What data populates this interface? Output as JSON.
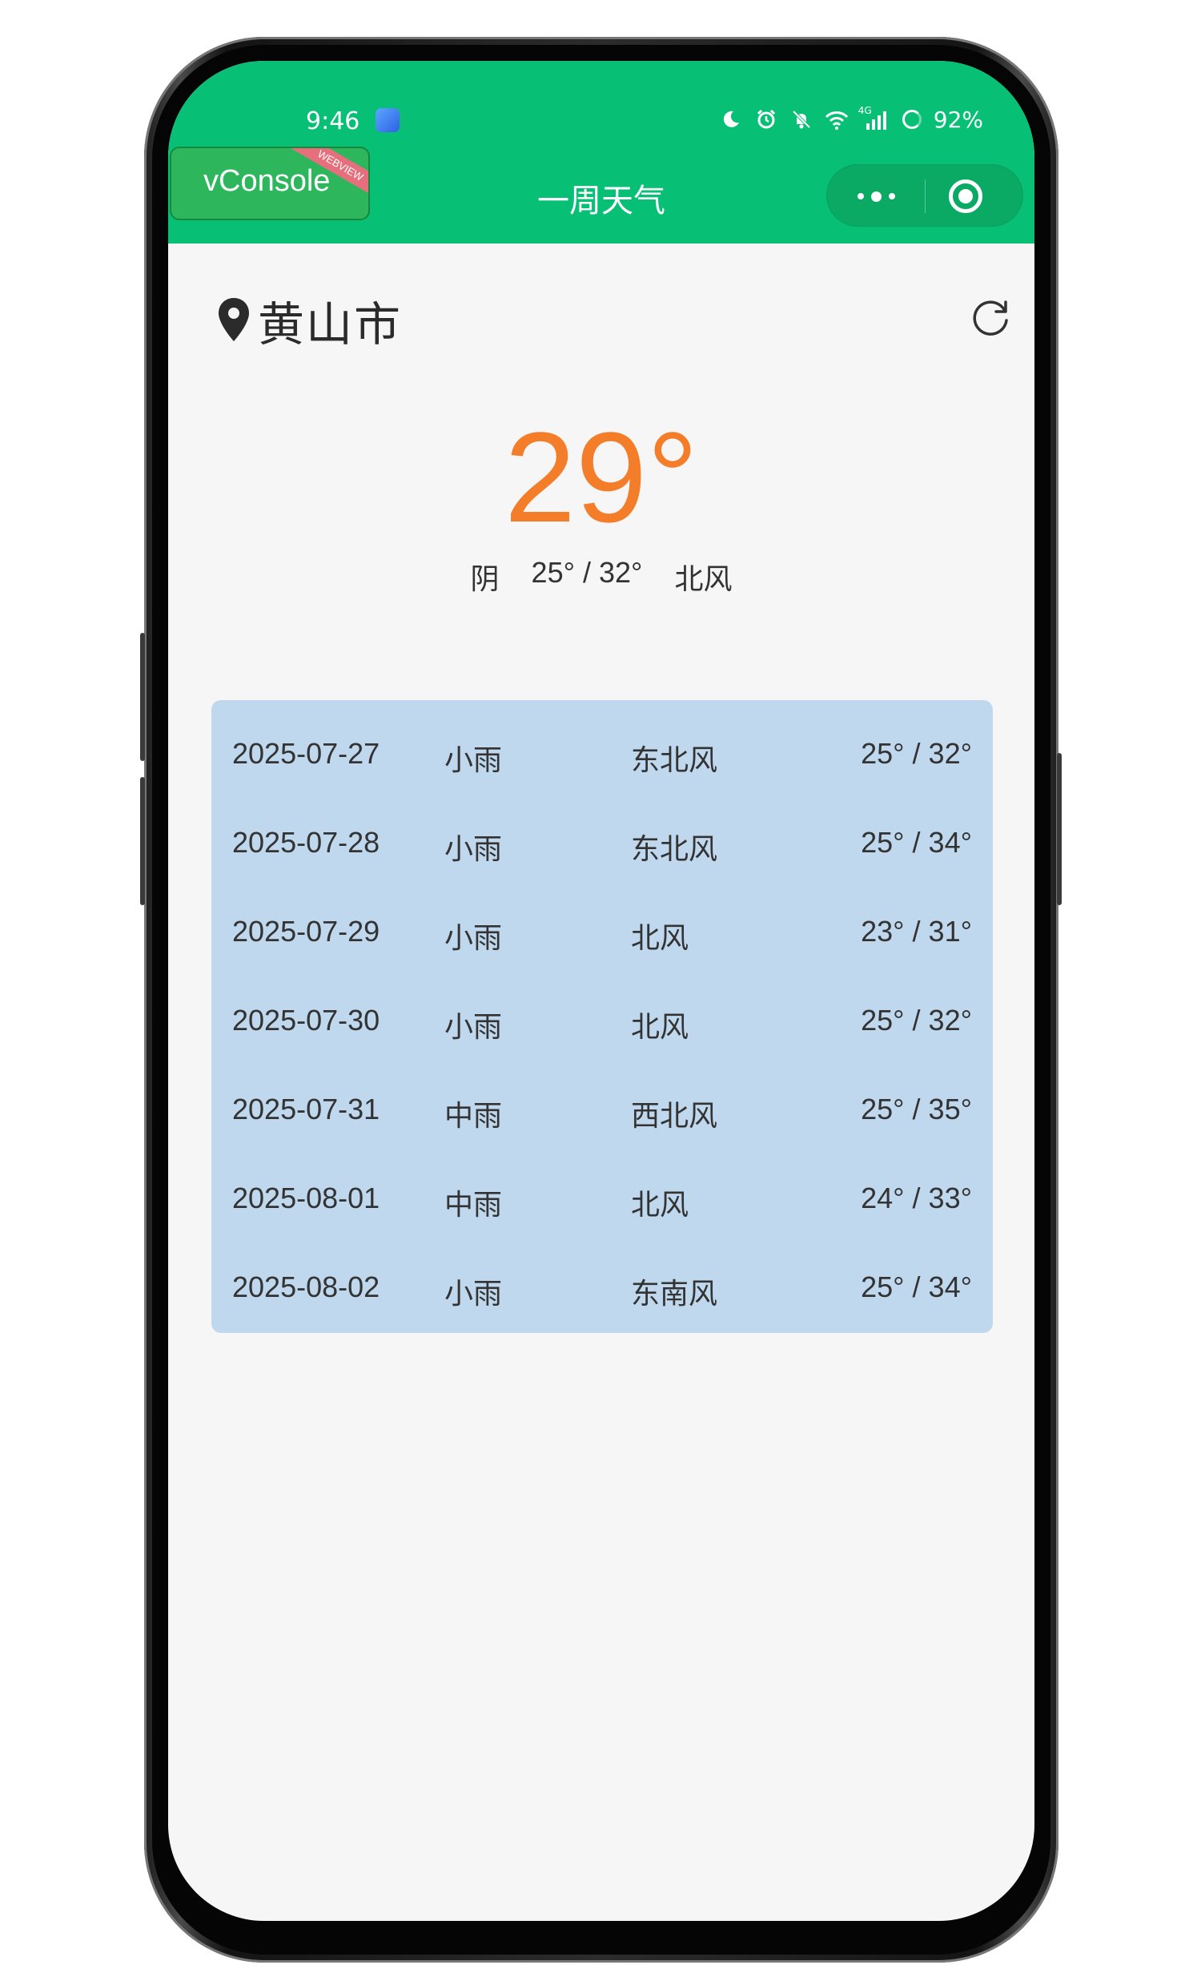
{
  "status_bar": {
    "time": "9:46",
    "battery": "92%"
  },
  "nav": {
    "vconsole_label": "vConsole",
    "vconsole_ribbon": "WEBVIEW",
    "title": "一周天气"
  },
  "location": {
    "city": "黄山市"
  },
  "current": {
    "temperature": "29°",
    "condition": "阴",
    "range": "25° / 32°",
    "wind": "北风"
  },
  "forecast": [
    {
      "date": "2025-07-27",
      "weather": "小雨",
      "wind": "东北风",
      "range": "25° / 32°"
    },
    {
      "date": "2025-07-28",
      "weather": "小雨",
      "wind": "东北风",
      "range": "25° / 34°"
    },
    {
      "date": "2025-07-29",
      "weather": "小雨",
      "wind": "北风",
      "range": "23° / 31°"
    },
    {
      "date": "2025-07-30",
      "weather": "小雨",
      "wind": "北风",
      "range": "25° / 32°"
    },
    {
      "date": "2025-07-31",
      "weather": "中雨",
      "wind": "西北风",
      "range": "25° / 35°"
    },
    {
      "date": "2025-08-01",
      "weather": "中雨",
      "wind": "北风",
      "range": "24° / 33°"
    },
    {
      "date": "2025-08-02",
      "weather": "小雨",
      "wind": "东南风",
      "range": "25° / 34°"
    }
  ],
  "colors": {
    "nav_green": "#07c075",
    "temperature_orange": "#f47d2a",
    "forecast_card": "#bfd8ee",
    "page_background": "#f6f6f6"
  },
  "icons": {
    "location": "map-pin-icon",
    "refresh": "refresh-icon",
    "more": "more-dots-icon",
    "close": "target-circle-icon"
  }
}
